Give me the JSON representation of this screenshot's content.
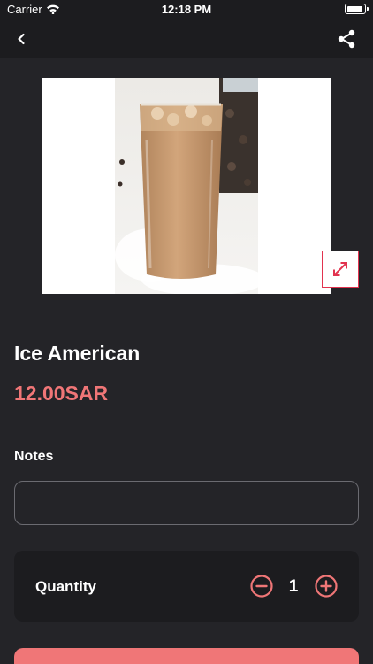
{
  "status_bar": {
    "carrier": "Carrier",
    "time": "12:18 PM",
    "battery_level": 0.9
  },
  "nav": {
    "back_icon": "chevron-left-icon",
    "share_icon": "share-icon"
  },
  "product": {
    "name": "Ice American",
    "price": "12.00SAR"
  },
  "notes": {
    "label": "Notes",
    "value": ""
  },
  "quantity": {
    "label": "Quantity",
    "value": "1"
  },
  "colors": {
    "accent": "#f07677",
    "background": "#242428",
    "surface": "#1c1c1f",
    "expand_border": "#e2334f"
  }
}
